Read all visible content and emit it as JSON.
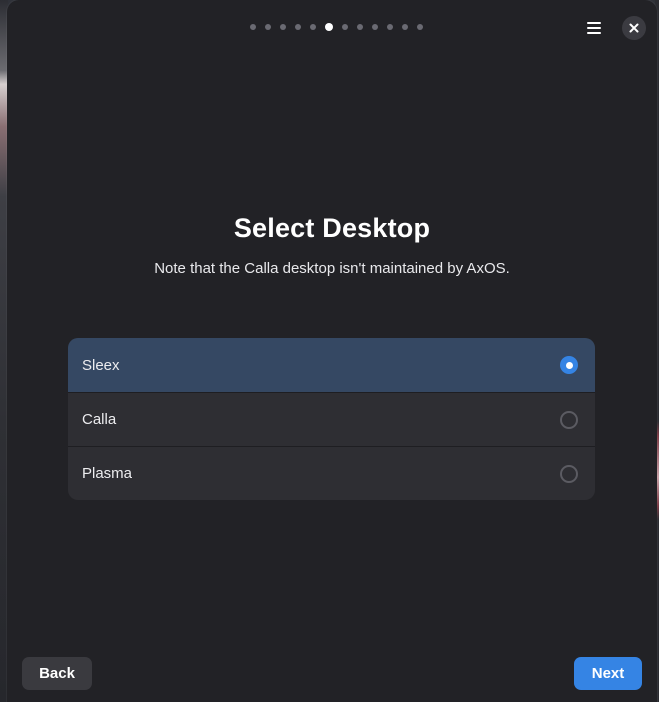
{
  "header": {
    "step_count": 12,
    "active_step": 6,
    "menu_icon": "hamburger-menu-icon",
    "close_icon": "close-icon"
  },
  "main": {
    "title": "Select Desktop",
    "subtitle": "Note that the Calla desktop isn't maintained by AxOS."
  },
  "desktops": [
    {
      "label": "Sleex",
      "selected": true
    },
    {
      "label": "Calla",
      "selected": false
    },
    {
      "label": "Plasma",
      "selected": false
    }
  ],
  "footer": {
    "back_label": "Back",
    "next_label": "Next"
  },
  "colors": {
    "accent": "#3584e4",
    "selected_row": "#354863",
    "window_bg": "#222226"
  }
}
